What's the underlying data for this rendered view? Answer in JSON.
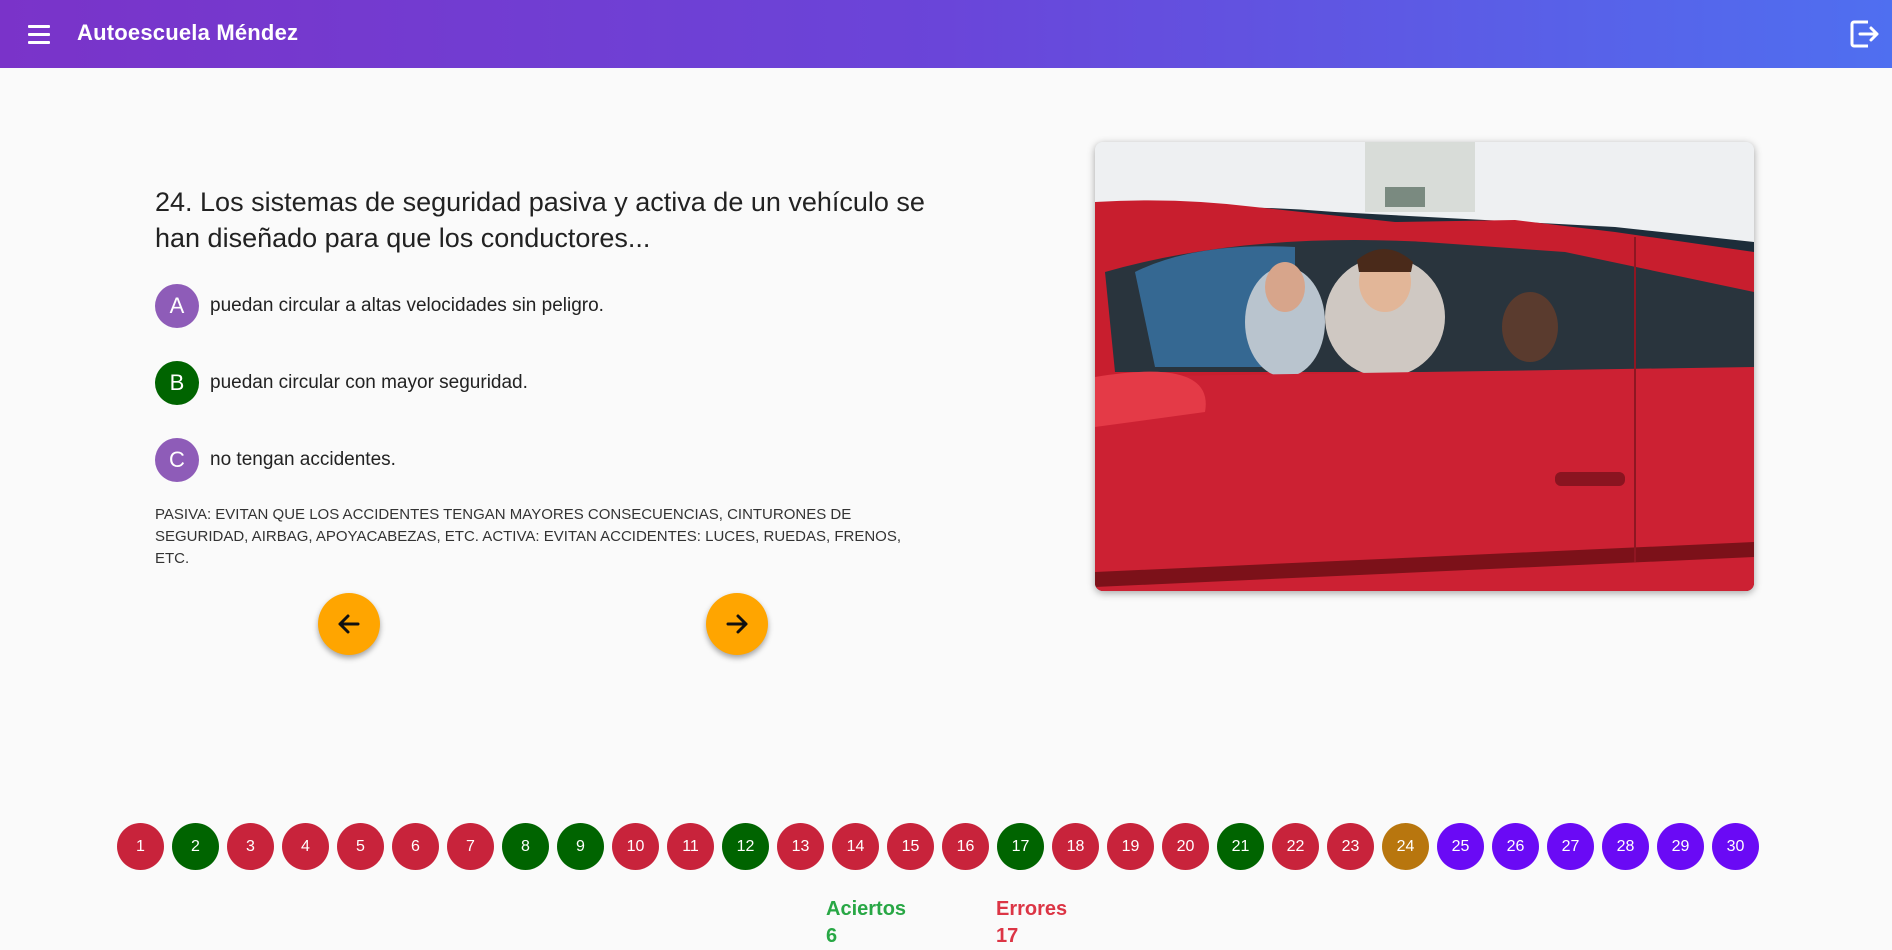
{
  "header": {
    "title": "Autoescuela Méndez",
    "menu_icon": "menu-icon",
    "logout_icon": "logout-icon",
    "gradient": [
      "#7a33c9",
      "#4f6ff0"
    ]
  },
  "question": {
    "text": "24. Los sistemas de seguridad pasiva y activa de un vehículo se han diseñado para que los conductores...",
    "answers": [
      {
        "letter": "A",
        "text": "puedan circular a altas velocidades sin peligro.",
        "color": "#8e5cb8",
        "state": "unselected"
      },
      {
        "letter": "B",
        "text": "puedan circular con mayor seguridad.",
        "color": "#006400",
        "state": "correct"
      },
      {
        "letter": "C",
        "text": "no tengan accidentes.",
        "color": "#8e5cb8",
        "state": "unselected"
      }
    ],
    "explanation": "PASIVA: EVITAN QUE LOS ACCIDENTES TENGAN MAYORES CONSECUENCIAS, CINTURONES DE SEGURIDAD, AIRBAG, APOYACABEZAS, ETC. ACTIVA: EVITAN ACCIDENTES: LUCES, RUEDAS, FRENOS, ETC."
  },
  "navigation": {
    "prev_icon": "arrow-left-icon",
    "next_icon": "arrow-right-icon",
    "button_color": "#ffa500"
  },
  "image": {
    "subject": "red car with driver",
    "icon": "car-photo"
  },
  "questions": {
    "numbers": [
      "1",
      "2",
      "3",
      "4",
      "5",
      "6",
      "7",
      "8",
      "9",
      "10",
      "11",
      "12",
      "13",
      "14",
      "15",
      "16",
      "17",
      "18",
      "19",
      "20",
      "21",
      "22",
      "23",
      "24",
      "25",
      "26",
      "27",
      "28",
      "29",
      "30"
    ],
    "status": [
      "wrong",
      "correct",
      "wrong",
      "wrong",
      "wrong",
      "wrong",
      "wrong",
      "correct",
      "correct",
      "wrong",
      "wrong",
      "correct",
      "wrong",
      "wrong",
      "wrong",
      "wrong",
      "correct",
      "wrong",
      "wrong",
      "wrong",
      "correct",
      "wrong",
      "wrong",
      "current",
      "pending",
      "pending",
      "pending",
      "pending",
      "pending",
      "pending"
    ],
    "colors": {
      "wrong": "#c8233b",
      "correct": "#006400",
      "current": "#b8760e",
      "pending": "#6a0af5"
    }
  },
  "score": {
    "correct_label": "Aciertos",
    "correct_value": "6",
    "correct_color": "#28a745",
    "errors_label": "Errores",
    "errors_value": "17",
    "errors_color": "#dc3545"
  }
}
